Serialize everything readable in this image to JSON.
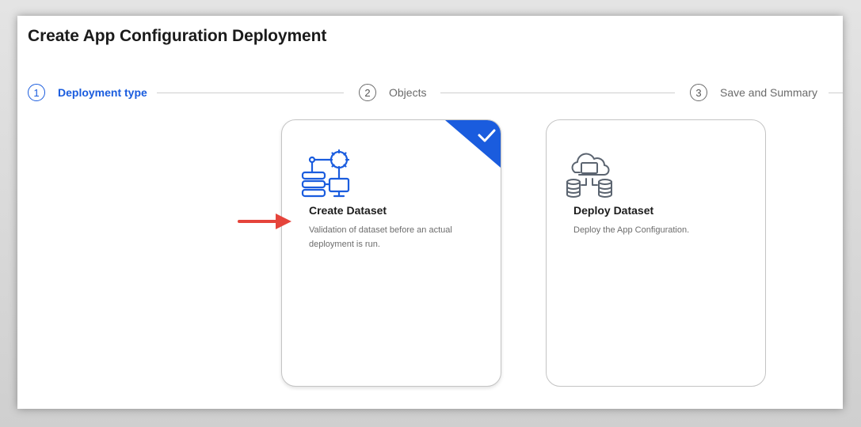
{
  "page": {
    "title": "Create App Configuration Deployment"
  },
  "stepper": [
    {
      "number": "1",
      "label": "Deployment type",
      "state": "active"
    },
    {
      "number": "2",
      "label": "Objects",
      "state": "inactive"
    },
    {
      "number": "3",
      "label": "Save and Summary",
      "state": "inactive"
    }
  ],
  "cards": [
    {
      "title": "Create Dataset",
      "description": "Validation of dataset before an actual deployment is run.",
      "icon": "dataset-network-icon",
      "selected": true
    },
    {
      "title": "Deploy Dataset",
      "description": "Deploy the App Configuration.",
      "icon": "cloud-database-icon",
      "selected": false
    }
  ],
  "colors": {
    "accent": "#1a5cde",
    "annotation_arrow": "#e5443b"
  }
}
